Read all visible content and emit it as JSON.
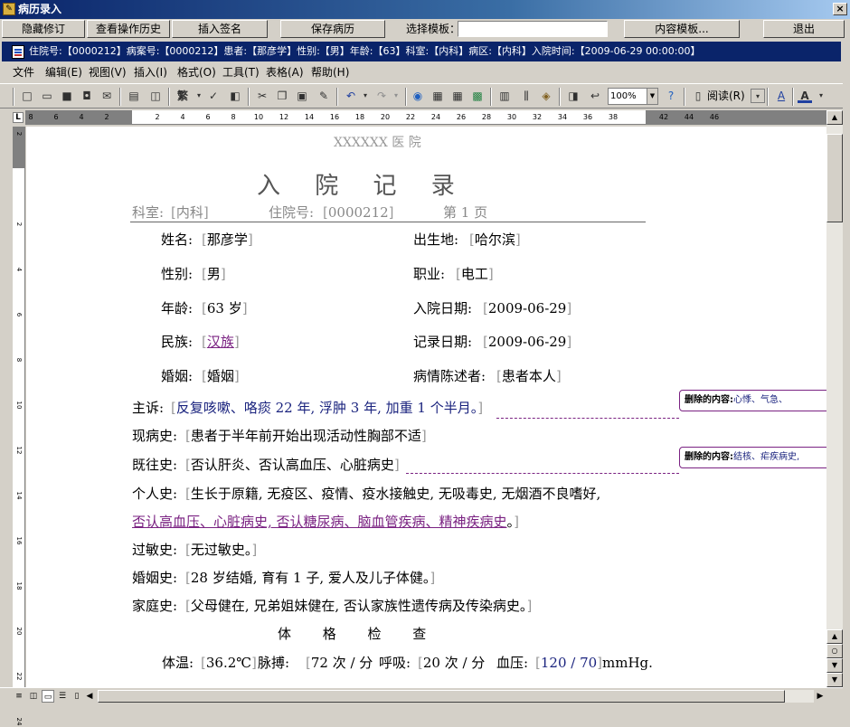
{
  "window": {
    "title": "病历录入",
    "close": "×"
  },
  "topbar": {
    "hide_revisions": "隐藏修订",
    "view_history": "查看操作历史",
    "insert_signature": "插入签名",
    "save_record": "保存病历",
    "template_label": "选择模板：",
    "template_value": "",
    "content_template": "内容模板...",
    "exit": "退出"
  },
  "docbar": {
    "text": "住院号:【0000212】病案号:【0000212】患者:【那彦学】性别:【男】年龄:【63】科室:【内科】病区:【内科】入院时间:【2009-06-29 00:00:00】"
  },
  "menu": [
    "文件",
    "编辑(E)",
    "视图(V)",
    "插入(I)",
    "格式(O)",
    "工具(T)",
    "表格(A)",
    "帮助(H)"
  ],
  "toolbar": {
    "zoom": "100%",
    "read_label": "阅读(R)",
    "font_char": "繁"
  },
  "ruler": {
    "h_ticks": [
      "8",
      "6",
      "4",
      "2",
      "",
      "2",
      "4",
      "6",
      "8",
      "10",
      "12",
      "14",
      "16",
      "18",
      "20",
      "22",
      "24",
      "26",
      "28",
      "30",
      "32",
      "34",
      "36",
      "38",
      "",
      "42",
      "44",
      "46"
    ],
    "v_ticks": [
      "2",
      "",
      "2",
      "4",
      "6",
      "8",
      "10",
      "12",
      "14",
      "16",
      "18",
      "20",
      "22",
      "24"
    ]
  },
  "doc": {
    "hospital": "XXXXXX 医 院",
    "title": "入 院 记 录",
    "dept_label": "科室:",
    "dept": "内科",
    "inpatient_label": "住院号:",
    "inpatient_no": "0000212",
    "page_label": "第 1 页",
    "rows": [
      {
        "l_label": "姓名:",
        "l_val": "那彦学",
        "r_label": "出生地:",
        "r_val": "哈尔滨"
      },
      {
        "l_label": "性别:",
        "l_val": "男",
        "r_label": "职业:",
        "r_val": "电工"
      },
      {
        "l_label": "年龄:",
        "l_val": "63 岁",
        "r_label": "入院日期:",
        "r_val": "2009-06-29"
      },
      {
        "l_label": "民族:",
        "l_val": "汉族",
        "r_label": "记录日期:",
        "r_val": "2009-06-29"
      },
      {
        "l_label": "婚姻:",
        "l_val": "婚姻",
        "r_label": "病情陈述者:",
        "r_val": "患者本人"
      }
    ],
    "complaint_label": "主诉:",
    "complaint": "反复咳嗽、咯痰 22 年, 浮肿 3 年, 加重 1 个半月。",
    "present_label": "现病史:",
    "present": "患者于半年前开始出现活动性胸部不适",
    "past_label": "既往史:",
    "past": "否认肝炎、否认高血压、心脏病史",
    "personal_label": "个人史:",
    "personal": "生长于原籍, 无疫区、疫情、疫水接触史, 无吸毒史, 无烟酒不良嗜好,",
    "personal_2": "否认高血压、心脏病史, 否认糖尿病、脑血管疾病、精神疾病史",
    "personal_2_end": "。",
    "allergy_label": "过敏史:",
    "allergy": "无过敏史。",
    "marriage_label": "婚姻史:",
    "marriage": "28 岁结婚, 育有 1 子, 爱人及儿子体健。",
    "family_label": "家庭史:",
    "family": "父母健在, 兄弟姐妹健在, 否认家族性遗传病及传染病史。",
    "exam_title": "体 格 检 查",
    "temp_label": "体温:",
    "temp": "36.2℃",
    "pulse_label": "脉搏:",
    "pulse": "72 次 / 分",
    "resp_label": "呼吸:",
    "resp": "20 次 / 分",
    "bp_label": "血压:",
    "bp": "120 / 70",
    "bp_unit": "mmHg."
  },
  "notes": [
    {
      "label": "删除的内容:",
      "value": "心悸、气急、"
    },
    {
      "label": "删除的内容:",
      "value": "结核、疟疾病史,"
    }
  ],
  "colors": {
    "title_bar": "#0a246a",
    "revision": "#7a2282",
    "field_text": "#1a237e"
  }
}
